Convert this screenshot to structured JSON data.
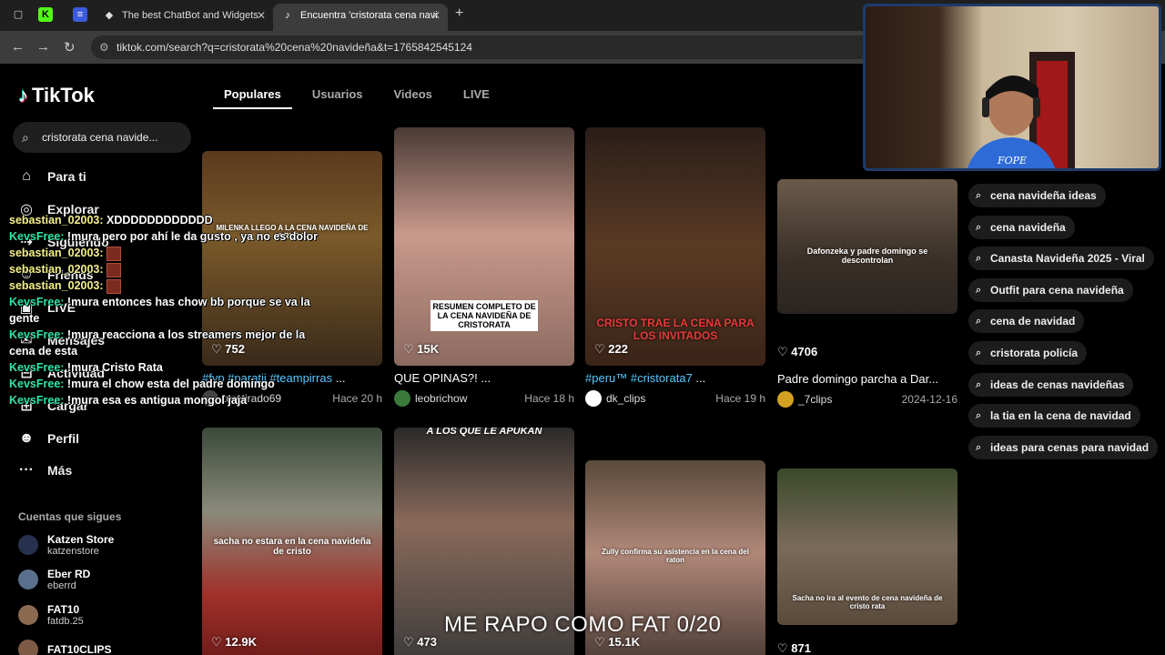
{
  "browser": {
    "tabs": [
      {
        "label": "The best ChatBot and Widgets",
        "active": false
      },
      {
        "label": "Encuentra 'cristorata cena navi",
        "active": true
      }
    ],
    "url": "tiktok.com/search?q=cristorata%20cena%20navideña&t=1765842545124"
  },
  "tiktok": {
    "logo": "TikTok",
    "search_value": "cristorata cena navide...",
    "sidebar": [
      {
        "label": "Para ti",
        "icon": "home-icon"
      },
      {
        "label": "Explorar",
        "icon": "compass-icon"
      },
      {
        "label": "Siguiendo",
        "icon": "following-icon"
      },
      {
        "label": "Friends",
        "icon": "friends-icon"
      },
      {
        "label": "LIVE",
        "icon": "live-icon"
      },
      {
        "label": "Mensajes",
        "icon": "messages-icon"
      },
      {
        "label": "Actividad",
        "icon": "activity-icon"
      },
      {
        "label": "Cargar",
        "icon": "upload-icon"
      },
      {
        "label": "Perfil",
        "icon": "profile-icon"
      },
      {
        "label": "Más",
        "icon": "more-icon"
      }
    ],
    "following_title": "Cuentas que sigues",
    "following": [
      {
        "name": "Katzen Store",
        "handle": "katzenstore"
      },
      {
        "name": "Eber RD",
        "handle": "eberrd"
      },
      {
        "name": "FAT10",
        "handle": "fatdb.25"
      },
      {
        "name": "FAT10CLIPS",
        "handle": ""
      }
    ],
    "search_tabs": [
      "Populares",
      "Usuarios",
      "Videos",
      "LIVE"
    ],
    "videos_row1": [
      {
        "plays": "752",
        "overlay": "MILENKA LLEGO A LA CENA NAVIDEÑA DE CRISTO",
        "desc_tags": "#fyp #paratii #teampirras",
        "desc_text": " ...",
        "user": "turetirado69",
        "when": "Hace 20 h"
      },
      {
        "plays": "15K",
        "overlay": "RESUMEN COMPLETO DE LA CENA NAVIDEÑA DE CRISTORATA",
        "desc_tags": "",
        "desc_text": "QUE OPINAS?! ...",
        "user": "leobrichow",
        "when": "Hace 18 h"
      },
      {
        "plays": "222",
        "overlay": "CRISTO TRAE LA CENA PARA LOS INVITADOS",
        "desc_tags": "#peru™ #cristorata7",
        "desc_text": " ...",
        "user": "dk_clips",
        "when": "Hace 19 h"
      },
      {
        "plays": "4706",
        "overlay": "Dafonzeka y padre domingo se descontrolan",
        "desc_tags": "",
        "desc_text": "Padre domingo parcha a Dar...",
        "user": "_7clips",
        "when": "2024-12-16"
      }
    ],
    "videos_row2": [
      {
        "plays": "12.9K",
        "overlay": "sacha no estara en la cena navideña de cristo"
      },
      {
        "plays": "473",
        "overlay": "A LOS QUE LE APUKAN"
      },
      {
        "plays": "15.1K",
        "overlay": "Zully confirma su asistencia en la cena del raton"
      },
      {
        "plays": "871",
        "overlay": "Sacha no ira al evento de cena navideña de cristo rata"
      }
    ],
    "related": [
      "cena navideña ideas",
      "cena navideña",
      "Canasta Navideña 2025 - Viral",
      "Outfit para cena navideña",
      "cena de navidad",
      "cristorata policía",
      "ideas de cenas navideñas",
      "la tia en la cena de navidad",
      "ideas para cenas para navidad"
    ]
  },
  "webcam": {
    "label": "FOPE"
  },
  "chat": [
    {
      "user": "sebastian_02003:",
      "text": " XDDDDDDDDDDDD",
      "style": "user2"
    },
    {
      "user": "KevsFree:",
      "text": " !mura pero por ahí le da gusto , ya no es dolor",
      "style": "user"
    },
    {
      "user": "sebastian_02003:",
      "text": "",
      "style": "user2",
      "box": true
    },
    {
      "user": "sebastian_02003:",
      "text": "",
      "style": "user2",
      "box": true
    },
    {
      "user": "sebastian_02003:",
      "text": "",
      "style": "user2",
      "box": true
    },
    {
      "user": "KevsFree:",
      "text": " !mura entonces has chow bb porque se va la gente",
      "style": "user"
    },
    {
      "user": "KevsFree:",
      "text": " !mura reacciona a los streamers mejor de la cena de esta",
      "style": "user"
    },
    {
      "user": "KevsFree:",
      "text": " !mura Cristo Rata",
      "style": "user"
    },
    {
      "user": "KevsFree:",
      "text": " !mura el chow esta del padre domingo",
      "style": "user"
    },
    {
      "user": "KevsFree:",
      "text": " !mura esa es antigua mongol jaja",
      "style": "user"
    }
  ],
  "caption": "ME RAPO COMO FAT 0/20",
  "colors": {
    "tag": "#58c8ff",
    "chat_user": "#2ce7a3",
    "chat_user2": "#f4ef8c"
  }
}
